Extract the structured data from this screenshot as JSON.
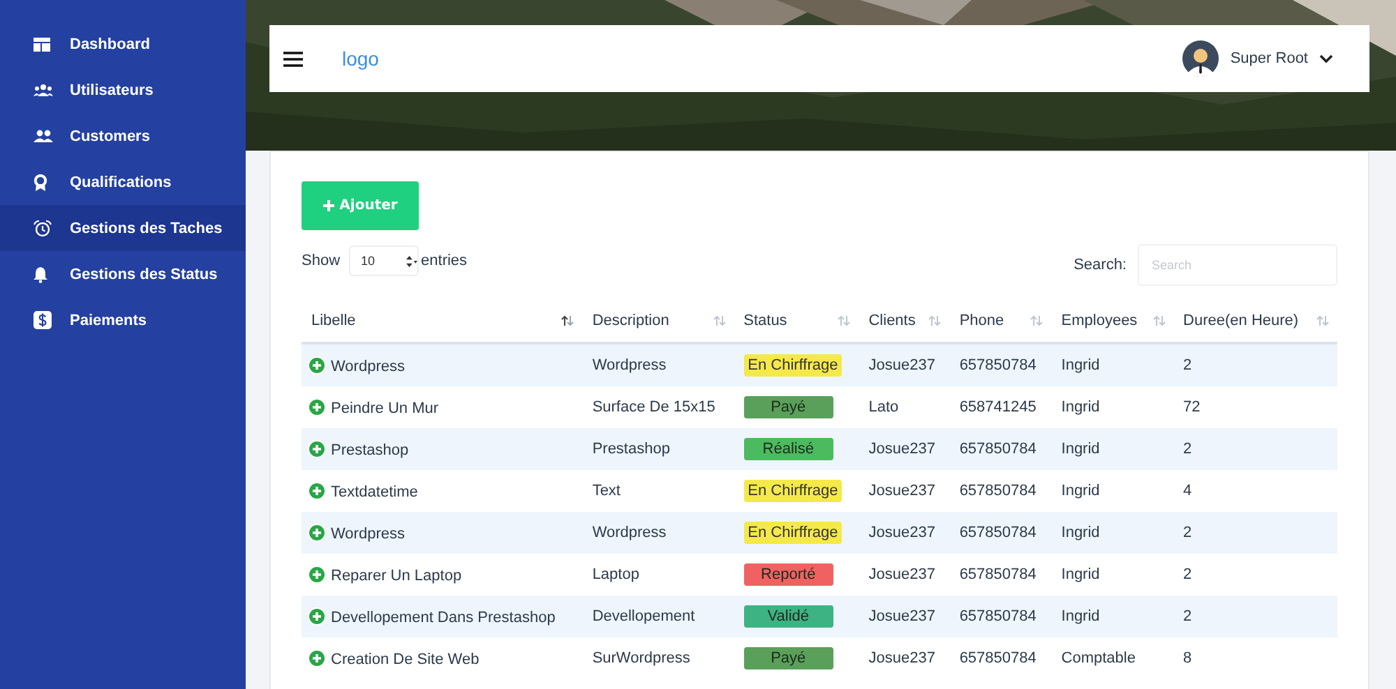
{
  "sidebar": {
    "items": [
      {
        "label": "Dashboard",
        "selected": false
      },
      {
        "label": "Utilisateurs",
        "selected": false
      },
      {
        "label": "Customers",
        "selected": false
      },
      {
        "label": "Qualifications",
        "selected": false
      },
      {
        "label": "Gestions des Taches",
        "selected": true
      },
      {
        "label": "Gestions des Status",
        "selected": false
      },
      {
        "label": "Paiements",
        "selected": false
      }
    ]
  },
  "header": {
    "logo": "logo",
    "user": "Super Root"
  },
  "toolbar": {
    "add_button": "Ajouter",
    "show_label": "Show",
    "entries_value": "10",
    "entries_label": "entries",
    "search_label": "Search:",
    "search_placeholder": "Search"
  },
  "table": {
    "columns": [
      {
        "label": "Libelle",
        "sorted": true
      },
      {
        "label": "Description",
        "sorted": false
      },
      {
        "label": "Status",
        "sorted": false
      },
      {
        "label": "Clients",
        "sorted": false
      },
      {
        "label": "Phone",
        "sorted": false
      },
      {
        "label": "Employees",
        "sorted": false
      },
      {
        "label": "Duree(en Heure)",
        "sorted": false
      }
    ],
    "rows": [
      {
        "libelle": "Wordpress",
        "description": "Wordpress",
        "status": "En Chirffrage",
        "color": "#f5e94a",
        "client": "Josue237",
        "phone": "657850784",
        "employee": "Ingrid",
        "duree": "2"
      },
      {
        "libelle": "Peindre Un Mur",
        "description": "Surface De 15x15",
        "status": "Payé",
        "color": "#5aa05a",
        "client": "Lato",
        "phone": "658741245",
        "employee": "Ingrid",
        "duree": "72"
      },
      {
        "libelle": "Prestashop",
        "description": "Prestashop",
        "status": "Réalisé",
        "color": "#4cbb5f",
        "client": "Josue237",
        "phone": "657850784",
        "employee": "Ingrid",
        "duree": "2"
      },
      {
        "libelle": "Textdatetime",
        "description": "Text",
        "status": "En Chirffrage",
        "color": "#f5e94a",
        "client": "Josue237",
        "phone": "657850784",
        "employee": "Ingrid",
        "duree": "4"
      },
      {
        "libelle": "Wordpress",
        "description": "Wordpress",
        "status": "En Chirffrage",
        "color": "#f5e94a",
        "client": "Josue237",
        "phone": "657850784",
        "employee": "Ingrid",
        "duree": "2"
      },
      {
        "libelle": "Reparer Un Laptop",
        "description": "Laptop",
        "status": "Reporté",
        "color": "#f06262",
        "client": "Josue237",
        "phone": "657850784",
        "employee": "Ingrid",
        "duree": "2"
      },
      {
        "libelle": "Devellopement Dans Prestashop",
        "description": "Devellopement",
        "status": "Validé",
        "color": "#3db383",
        "client": "Josue237",
        "phone": "657850784",
        "employee": "Ingrid",
        "duree": "2"
      },
      {
        "libelle": "Creation De Site Web",
        "description": "SurWordpress",
        "status": "Payé",
        "color": "#5aa05a",
        "client": "Josue237",
        "phone": "657850784",
        "employee": "Comptable",
        "duree": "8"
      }
    ]
  }
}
